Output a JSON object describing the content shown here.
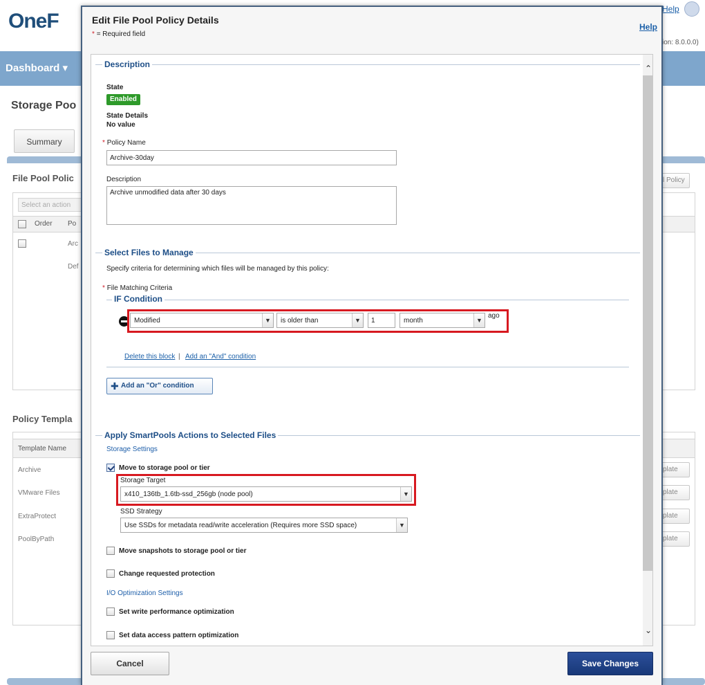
{
  "background": {
    "logo": "OneF",
    "help": "Help",
    "version": "ion: 8.0.0.0)",
    "nav": "Dashboard ▾",
    "page_title": "Storage Poo",
    "tab": "Summary",
    "policies_title": "File Pool Polic",
    "select_action": "Select an action",
    "col_order": "Order",
    "col_policy": "Po",
    "row1": "Arc",
    "row2": "Def",
    "create_policy": "l Policy",
    "templates_title": "Policy Templa",
    "col_template": "Template Name",
    "templates": [
      "Archive",
      "VMware Files",
      "ExtraProtect",
      "PoolByPath"
    ],
    "template_btn": "plate"
  },
  "dialog": {
    "title": "Edit File Pool Policy Details",
    "required_note": "= Required field",
    "required_mark": "*",
    "help": "Help",
    "description_section": {
      "heading": "Description",
      "state_label": "State",
      "state_value": "Enabled",
      "state_details_label": "State Details",
      "state_details_value": "No value",
      "policy_name_label": "Policy Name",
      "policy_name_value": "Archive-30day",
      "description_label": "Description",
      "description_value": "Archive unmodified data after 30 days"
    },
    "select_files_section": {
      "heading": "Select Files to Manage",
      "instructions": "Specify criteria for determining which files will be managed by this policy:",
      "criteria_label": "File Matching Criteria",
      "if_condition": "IF Condition",
      "attribute": "Modified",
      "operator": "is older than",
      "amount": "1",
      "unit": "month",
      "suffix": "ago",
      "delete_block": "Delete this block",
      "separator": "|",
      "add_and": "Add an \"And\" condition",
      "add_or": "Add an \"Or\" condition"
    },
    "actions_section": {
      "heading": "Apply SmartPools Actions to Selected Files",
      "storage_settings": "Storage Settings",
      "move_to_pool": "Move to storage pool or tier",
      "storage_target_label": "Storage Target",
      "storage_target_value": "x410_136tb_1.6tb-ssd_256gb (node pool)",
      "ssd_strategy_label": "SSD Strategy",
      "ssd_strategy_value": "Use SSDs for metadata read/write acceleration (Requires more SSD space)",
      "move_snapshots": "Move snapshots to storage pool or tier",
      "change_protection": "Change requested protection",
      "io_settings": "I/O Optimization Settings",
      "write_perf": "Set write performance optimization",
      "access_pattern": "Set data access pattern optimization"
    },
    "cancel": "Cancel",
    "save": "Save Changes"
  }
}
